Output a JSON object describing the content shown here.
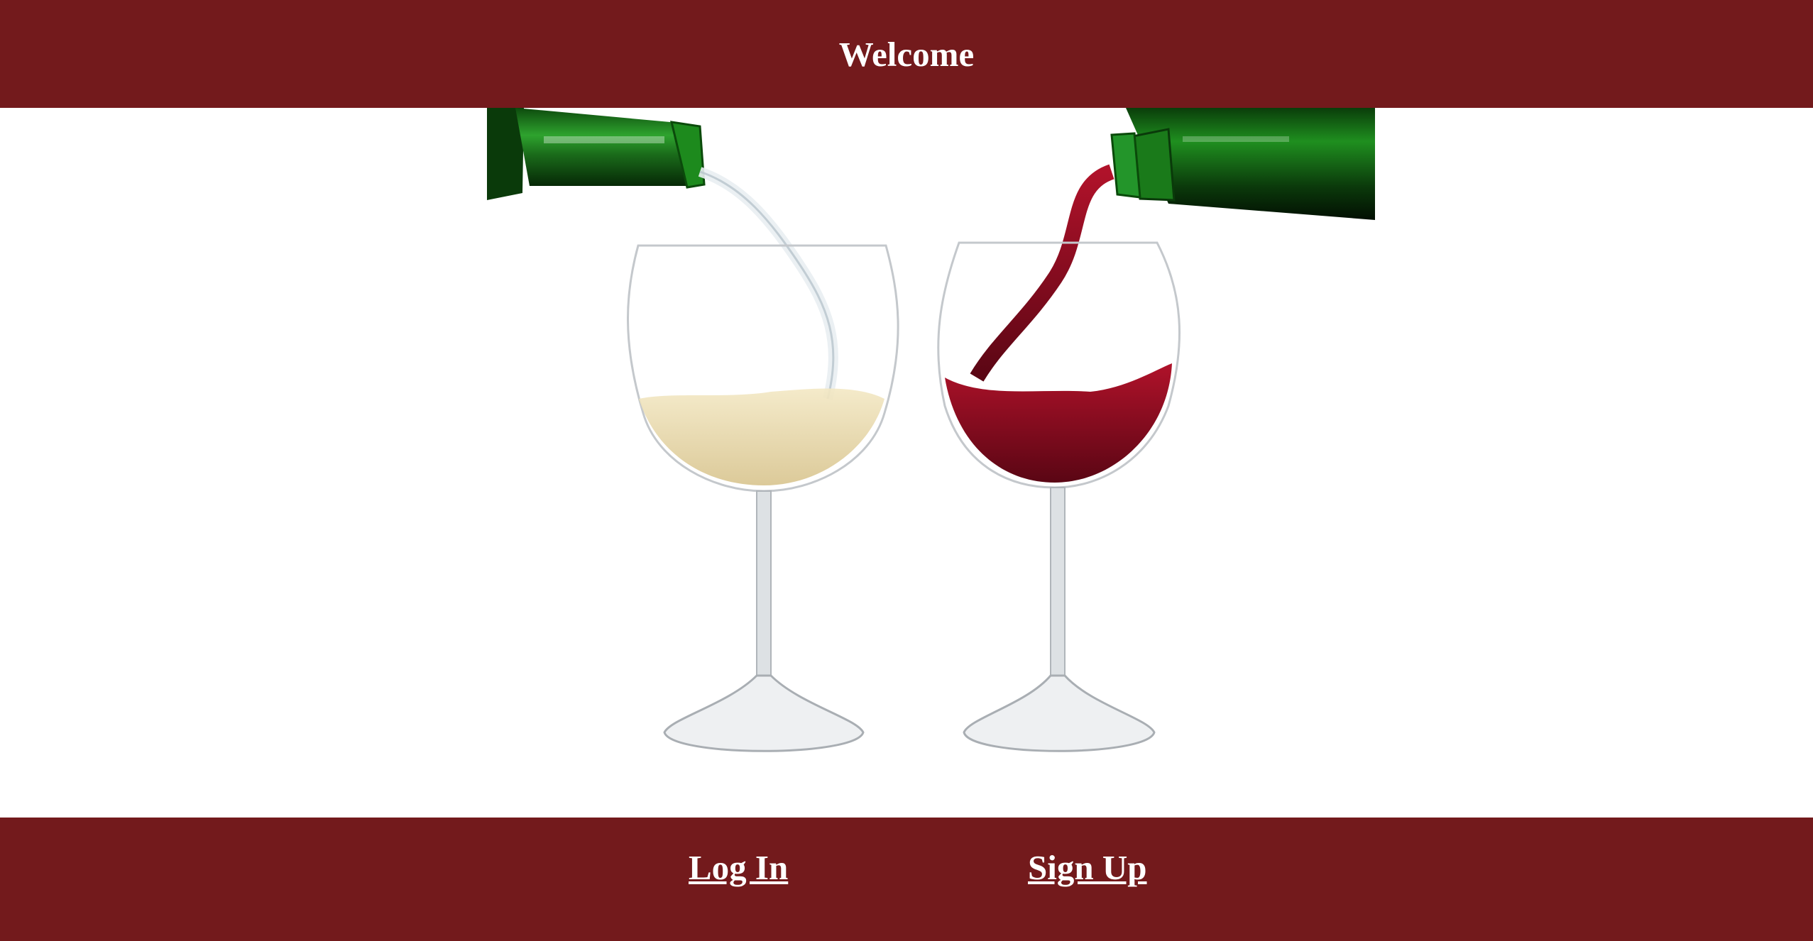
{
  "header": {
    "title": "Welcome"
  },
  "footer": {
    "login_label": "Log In",
    "signup_label": "Sign Up"
  },
  "hero": {
    "image": "wine-pouring-image"
  },
  "colors": {
    "brand": "#731a1c",
    "text": "#ffffff",
    "white_wine": "#e8d9a8",
    "red_wine": "#8a0d20",
    "bottle": "#1f7a1f"
  }
}
